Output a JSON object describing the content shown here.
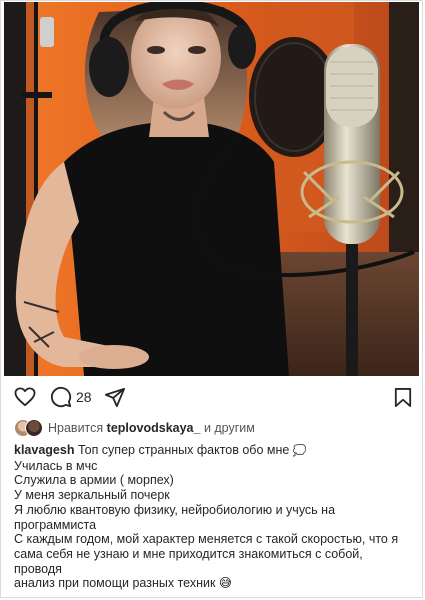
{
  "post": {
    "comment_count": "28",
    "likes": {
      "prefix": "Нравится",
      "user": "teplovodskaya_",
      "suffix": "и другим"
    },
    "caption": {
      "author": "klavagesh",
      "lines": [
        "Топ супер странных фактов обо мне",
        "Училась в мчс",
        "Служила в армии ( морпех)",
        "У меня зеркальный почерк",
        "Я люблю квантовую физику, нейробиологию и учусь на",
        "программиста",
        "С каждым годом, мой характер меняется с такой скоростью, что я",
        "сама себя не узнаю и мне приходится знакомиться с собой, проводя",
        "анализ при помощи разных техник 😅"
      ]
    }
  },
  "icons": {
    "like": "heart-icon",
    "comment": "comment-icon",
    "share": "send-icon",
    "save": "bookmark-icon"
  },
  "colors": {
    "text": "#262626",
    "border": "#dbdbdb",
    "studio_orange": "#e0661f"
  }
}
